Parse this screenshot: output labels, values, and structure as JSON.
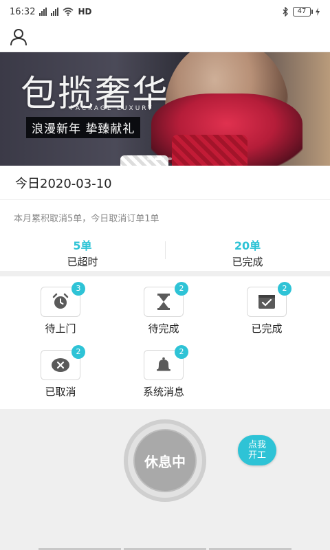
{
  "status_bar": {
    "time": "16:32",
    "network": "HD",
    "battery": "47"
  },
  "banner": {
    "title": "包揽奢华",
    "subtitle": "PACKAGE LUXURY",
    "tagline": "浪漫新年  挚臻献礼"
  },
  "date": {
    "label": "今日2020-03-10"
  },
  "summary": {
    "note": "本月累积取消5单，今日取消订单1单",
    "stats": [
      {
        "value": "5单",
        "label": "已超时"
      },
      {
        "value": "20单",
        "label": "已完成"
      }
    ]
  },
  "tiles": [
    {
      "label": "待上门",
      "badge": "3",
      "icon": "alarm-clock-icon"
    },
    {
      "label": "待完成",
      "badge": "2",
      "icon": "hourglass-icon"
    },
    {
      "label": "已完成",
      "badge": "2",
      "icon": "check-box-icon"
    },
    {
      "label": "已取消",
      "badge": "2",
      "icon": "cancel-icon"
    },
    {
      "label": "系统消息",
      "badge": "2",
      "icon": "bell-icon"
    }
  ],
  "work": {
    "status_label": "休息中",
    "start_button": "点我开工"
  },
  "colors": {
    "accent": "#2ec3d6",
    "icon_gray": "#5a5a5a",
    "rest_gray": "#a9a9a9"
  }
}
